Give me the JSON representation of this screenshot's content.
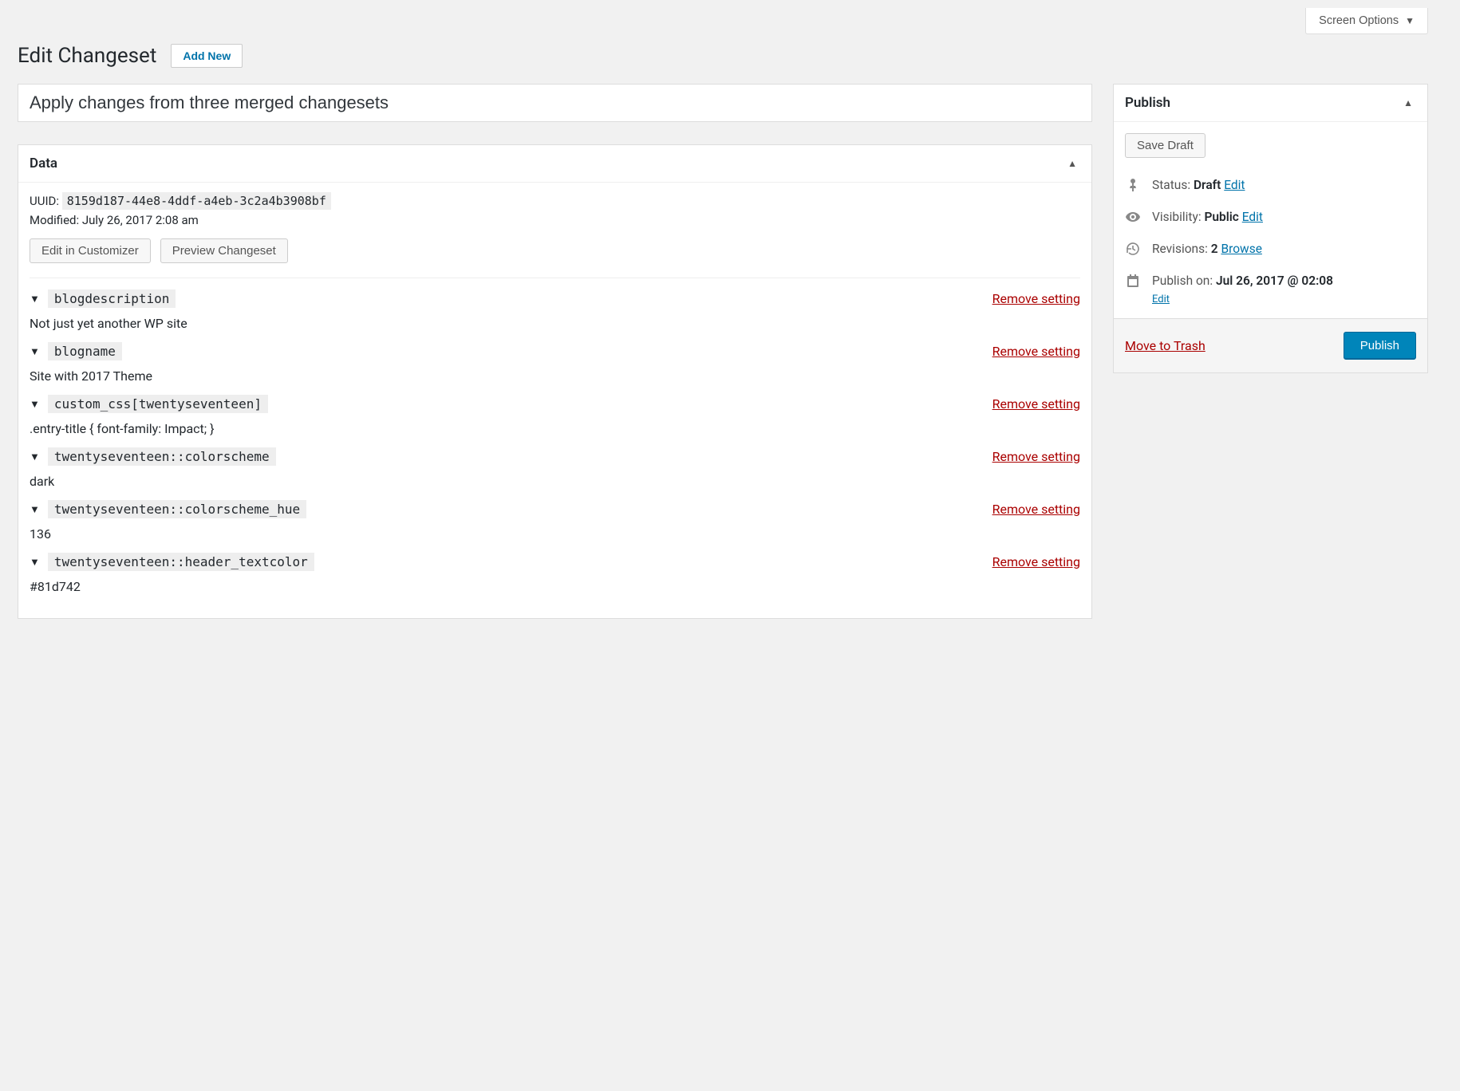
{
  "screen_options_label": "Screen Options",
  "page_title": "Edit Changeset",
  "add_new_label": "Add New",
  "title_value": "Apply changes from three merged changesets",
  "data_box": {
    "heading": "Data",
    "uuid_label": "UUID:",
    "uuid_value": "8159d187-44e8-4ddf-a4eb-3c2a4b3908bf",
    "modified_label": "Modified:",
    "modified_value": "July 26, 2017 2:08 am",
    "edit_customizer_label": "Edit in Customizer",
    "preview_label": "Preview Changeset",
    "remove_label": "Remove setting",
    "settings": [
      {
        "key": "blogdescription",
        "value": "Not just yet another WP site"
      },
      {
        "key": "blogname",
        "value": "Site with 2017 Theme"
      },
      {
        "key": "custom_css[twentyseventeen]",
        "value": ".entry-title { font-family: Impact; }"
      },
      {
        "key": "twentyseventeen::colorscheme",
        "value": "dark"
      },
      {
        "key": "twentyseventeen::colorscheme_hue",
        "value": "136"
      },
      {
        "key": "twentyseventeen::header_textcolor",
        "value": "#81d742"
      }
    ]
  },
  "publish_box": {
    "heading": "Publish",
    "save_draft_label": "Save Draft",
    "status_label": "Status:",
    "status_value": "Draft",
    "visibility_label": "Visibility:",
    "visibility_value": "Public",
    "revisions_label": "Revisions:",
    "revisions_count": "2",
    "browse_label": "Browse",
    "publish_on_label": "Publish on:",
    "publish_on_value": "Jul 26, 2017 @ 02:08",
    "edit_label": "Edit",
    "trash_label": "Move to Trash",
    "publish_button": "Publish"
  }
}
